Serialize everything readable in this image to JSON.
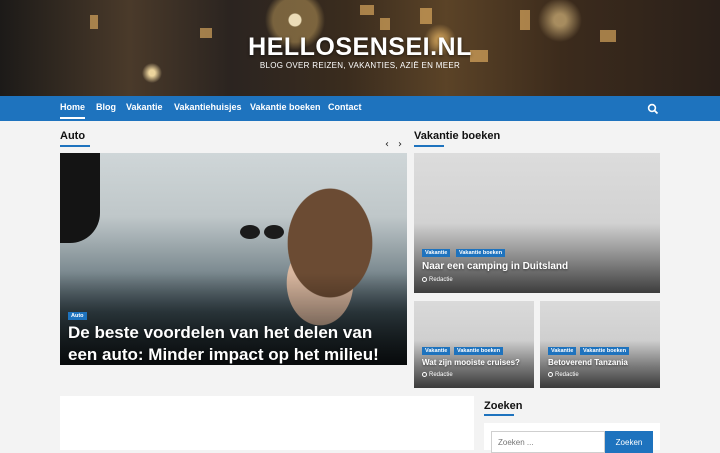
{
  "site": {
    "title": "HELLOSENSEI.NL",
    "tagline": "BLOG OVER REIZEN, VAKANTIES, AZIË EN MEER"
  },
  "nav": {
    "items": [
      {
        "label": "Home",
        "active": true
      },
      {
        "label": "Blog",
        "active": false
      },
      {
        "label": "Vakantie",
        "active": false
      },
      {
        "label": "Vakantiehuisjes",
        "active": false
      },
      {
        "label": "Vakantie boeken",
        "active": false
      },
      {
        "label": "Contact",
        "active": false
      }
    ],
    "search_icon": "search-icon"
  },
  "featured": {
    "section_title": "Auto",
    "prev_icon": "chevron-left-icon",
    "next_icon": "chevron-right-icon",
    "slide": {
      "category": "Auto",
      "title_line1": "De beste voordelen van het delen van",
      "title_line2": "een auto: Minder impact op het milieu!"
    }
  },
  "vakantie_boeken": {
    "section_title": "Vakantie boeken",
    "main": {
      "categories": [
        "Vakantie",
        "Vakantie boeken"
      ],
      "title": "Naar een camping in Duitsland",
      "author": "Redactie"
    },
    "small": [
      {
        "categories": [
          "Vakantie",
          "Vakantie boeken"
        ],
        "title": "Wat zijn mooiste cruises?",
        "author": "Redactie"
      },
      {
        "categories": [
          "Vakantie",
          "Vakantie boeken"
        ],
        "title": "Betoverend Tanzania",
        "author": "Redactie"
      }
    ]
  },
  "sidebar": {
    "search_title": "Zoeken",
    "search_placeholder": "Zoeken ...",
    "search_button": "Zoeken"
  },
  "colors": {
    "accent": "#1e73be",
    "background": "#f3f3f3"
  }
}
